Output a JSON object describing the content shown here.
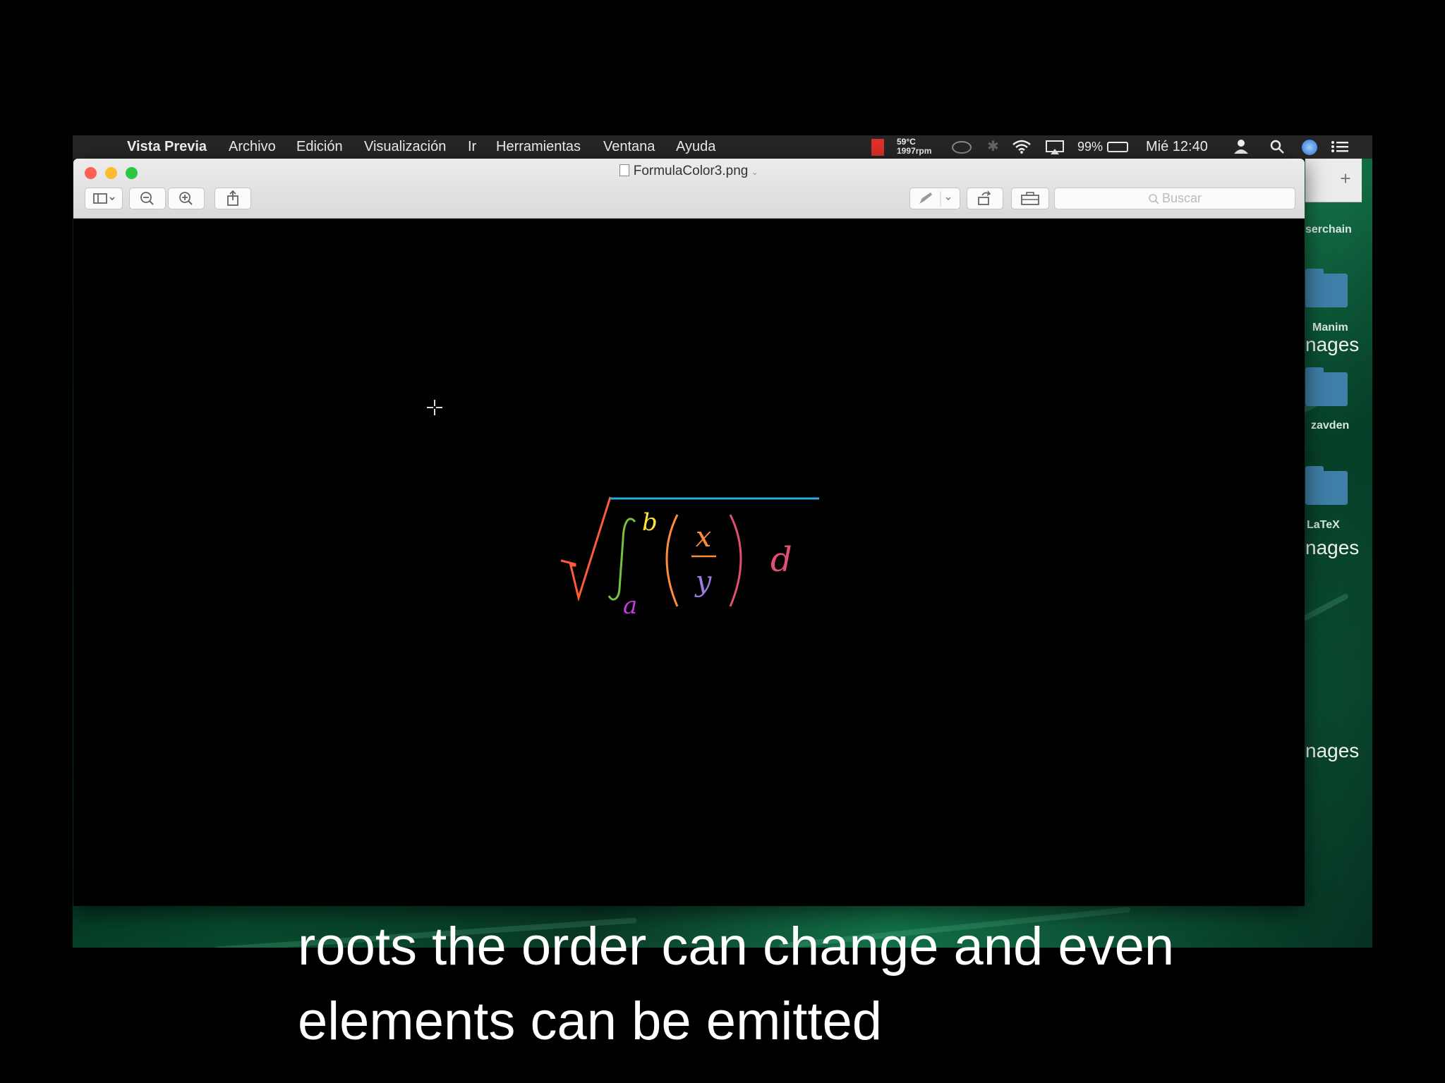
{
  "menubar": {
    "apple": "",
    "app_name": "Vista Previa",
    "items": [
      "Archivo",
      "Edición",
      "Visualización",
      "Ir",
      "Herramientas",
      "Ventana",
      "Ayuda"
    ],
    "temp": "59°C",
    "rpm": "1997rpm",
    "battery": "99%",
    "clock": "Mié 12:40"
  },
  "window": {
    "title": "FormulaColor3.png",
    "search_placeholder": "Buscar"
  },
  "desktop": {
    "labels": [
      "serchain",
      "Manim",
      "zavden",
      "LaTeX"
    ],
    "big_labels": [
      "nages",
      "nages",
      "nages"
    ]
  },
  "formula": {
    "upper_limit": "b",
    "lower_limit": "a",
    "numerator": "x",
    "denominator": "y",
    "differential": "d",
    "colors": {
      "radical": "#ff5a3c",
      "vinculum": "#29abe2",
      "integral": "#76c044",
      "upper": "#ffe13d",
      "lower": "#c03de0",
      "parens": "#ff8c3a",
      "numerator": "#ff8c3a",
      "denominator": "#9b7be0",
      "differential": "#e05070"
    }
  },
  "caption": {
    "line1": "roots the order can change and even",
    "line2": "elements can be emitted"
  }
}
